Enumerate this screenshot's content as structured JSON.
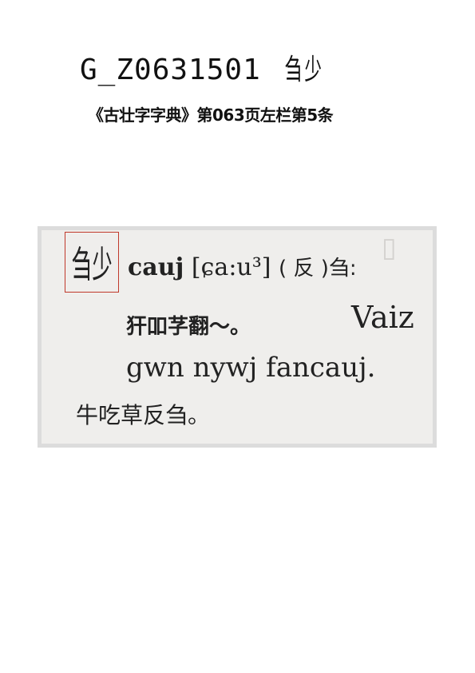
{
  "header": {
    "code": "G_Z0631501",
    "glyph_components": [
      "刍",
      "少"
    ]
  },
  "source": "《古壮字字典》第063页左栏第5条",
  "scan": {
    "headword_components": [
      "刍",
      "少"
    ],
    "line1": {
      "word": "cauj",
      "ipa": "[ɕa:u³]",
      "paren": "( 反 )刍:"
    },
    "line2_cn": "犴吅芓翻～。",
    "line2_latin": "Vaiz",
    "line3": "gwn nywj fancauj.",
    "line4": "牛吃草反刍。"
  },
  "colors": {
    "highlight_box": "#c0392b",
    "scan_background": "#efeeec",
    "scan_border": "#dcdcdc"
  }
}
